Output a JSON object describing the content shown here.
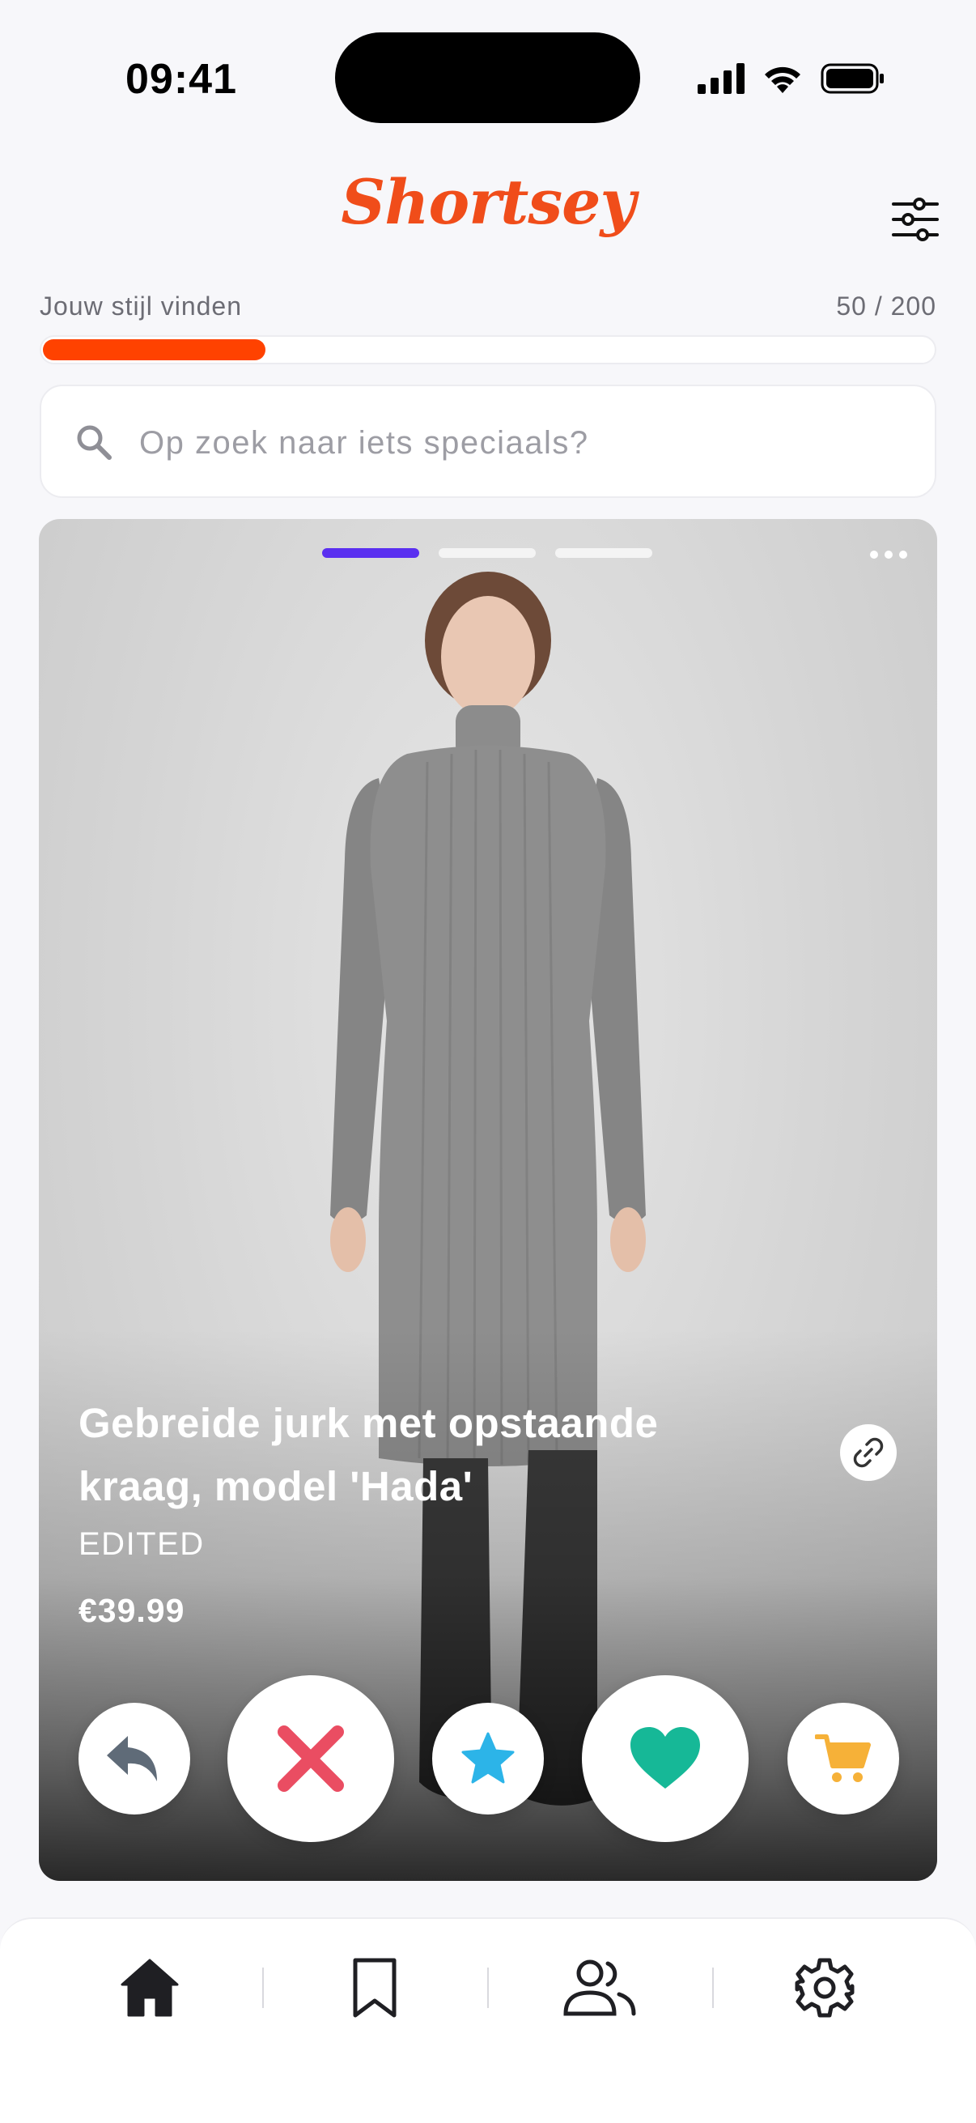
{
  "status_bar": {
    "time": "09:41",
    "icons": [
      "cellular-signal-icon",
      "wifi-icon",
      "battery-icon"
    ]
  },
  "header": {
    "logo_text": "Shortsey",
    "filter_icon": "sliders-icon"
  },
  "progress": {
    "label": "Jouw stijl vinden",
    "count": "50 / 200",
    "value": 50,
    "max": 200,
    "color": "#ff4200"
  },
  "search": {
    "placeholder": "Op zoek naar iets speciaals?",
    "value": ""
  },
  "card": {
    "image_count": 3,
    "active_image": 0,
    "indicator_active_color": "#5a2ff0",
    "product": {
      "title": "Gebreide jurk met opstaande kraag, model 'Hada'",
      "brand": "EDITED",
      "price": "€39.99"
    },
    "actions": [
      {
        "name": "undo",
        "icon": "undo-arrow-icon",
        "color": "#5f6b78"
      },
      {
        "name": "dislike",
        "icon": "close-icon",
        "color": "#ea4d62"
      },
      {
        "name": "superlike",
        "icon": "star-icon",
        "color": "#2cb4e8"
      },
      {
        "name": "like",
        "icon": "heart-icon",
        "color": "#16b897"
      },
      {
        "name": "cart",
        "icon": "cart-icon",
        "color": "#f6b138"
      }
    ]
  },
  "bottom_nav": {
    "items": [
      {
        "name": "home",
        "icon": "home-icon",
        "active": true
      },
      {
        "name": "saved",
        "icon": "bookmark-icon",
        "active": false
      },
      {
        "name": "social",
        "icon": "users-icon",
        "active": false
      },
      {
        "name": "settings",
        "icon": "gear-icon",
        "active": false
      }
    ]
  },
  "colors": {
    "brand": "#f04d1a",
    "background": "#f7f7fa"
  }
}
